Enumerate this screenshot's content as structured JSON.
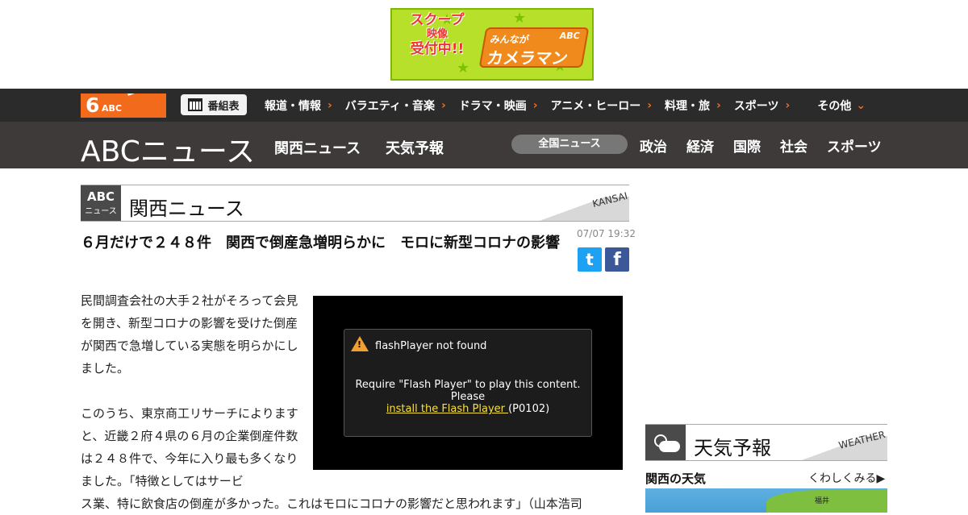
{
  "banner": {
    "scoop_line1": "スクープ",
    "scoop_line2": "映像",
    "scoop_line3": "受付中!!",
    "cam_sub": "みんなが",
    "cam_main": "カメラマン",
    "cam_abc": "ABC"
  },
  "topnav": {
    "logo_num": "6",
    "logo_abc": "ABC",
    "program_label": "番組表",
    "links": [
      "報道・情報",
      "バラエティ・音楽",
      "ドラマ・映画",
      "アニメ・ヒーロー",
      "料理・旅",
      "スポーツ",
      "その他"
    ]
  },
  "subnav": {
    "logo": "ABCニュース",
    "kansai_news": "関西ニュース",
    "weather": "天気予報",
    "zenkoku": "全国ニュース",
    "categories": [
      "政治",
      "経済",
      "国際",
      "社会",
      "スポーツ"
    ]
  },
  "section": {
    "badge_line1": "ABC",
    "badge_line2": "ニュース",
    "title": "関西ニュース",
    "en": "KANSAI"
  },
  "article": {
    "headline": "６月だけで２４８件　関西で倒産急増明らかに　モロに新型コロナの影響",
    "date": "07/07 19:32",
    "para1": "民間調査会社の大手２社がそろって会見を開き、新型コロナの影響を受けた倒産が関西で急増している実態を明らかにしました。",
    "para2": "このうち、東京商工リサーチによりますと、近畿２府４県の６月の企業倒産件数は２４８件で、今年に入り最も多くなりました。「特徴としてはサービ",
    "para3": "ス業、特に飲食店の倒産が多かった。これはモロにコロナの影響だと思われます」（山本浩司"
  },
  "player": {
    "title": "flashPlayer not found",
    "msg_line1": "Require \"Flash Player\" to play this content.",
    "msg_line2": "Please",
    "link": "install the Flash Player ",
    "code": "(P0102)"
  },
  "sidebar": {
    "weather_title": "天気予報",
    "weather_en": "WEATHER",
    "kansai_weather": "関西の天気",
    "more": "くわしくみる▶",
    "map_city": "福井"
  },
  "colors": {
    "accent": "#f26b1d",
    "topnav_bg": "#2b2b2b",
    "subnav_bg": "#3e3a3a",
    "twitter": "#1da1f2",
    "facebook": "#3b5998"
  }
}
